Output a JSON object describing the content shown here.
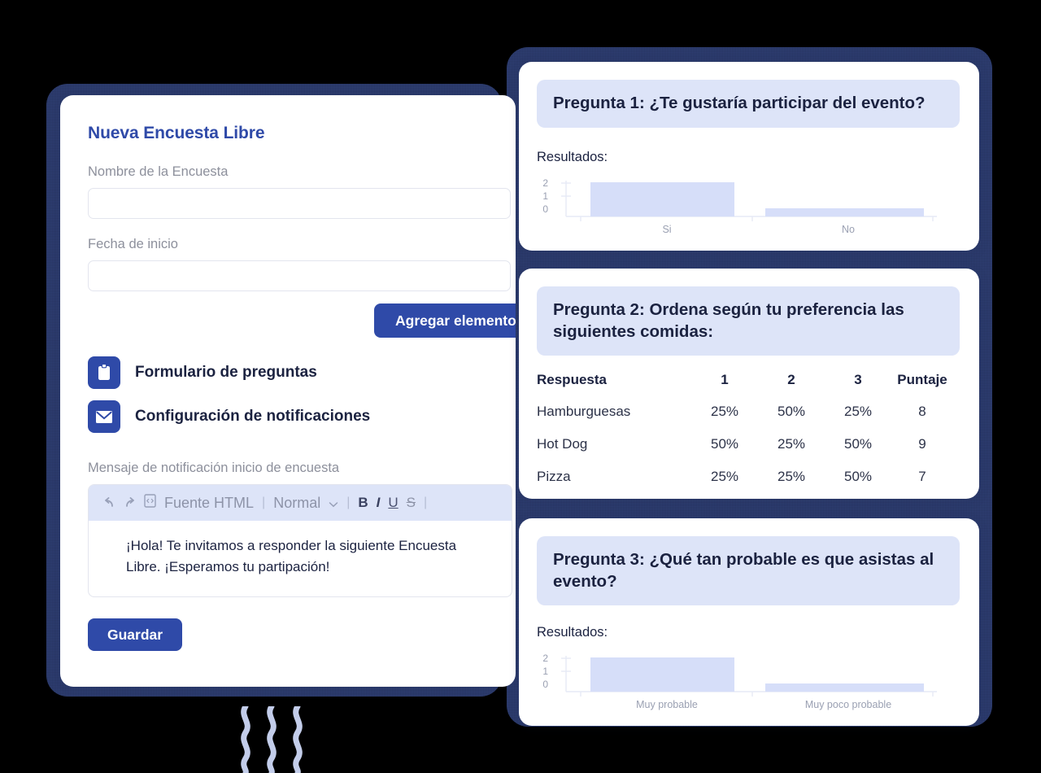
{
  "left_panel": {
    "title": "Nueva Encuesta Libre",
    "fields": [
      {
        "label": "Nombre de la Encuesta",
        "value": "",
        "placeholder": ""
      },
      {
        "label": "Fecha de inicio",
        "value": "",
        "placeholder": ""
      }
    ],
    "add_element_button": "Agregar elemento",
    "sections": [
      {
        "icon": "clipboard-icon",
        "label": "Formulario de preguntas"
      },
      {
        "icon": "envelope-icon",
        "label": "Configuración de notificaciones"
      }
    ],
    "editor_label": "Mensaje de notificación inicio de encuesta",
    "editor_toolbar": {
      "undo": "undo-icon",
      "redo": "redo-icon",
      "source_icon": "html-source-icon",
      "source_label": "Fuente HTML",
      "style_select": "Normal",
      "bold": "B",
      "italic": "I",
      "underline": "U",
      "strikethrough": "S"
    },
    "editor_body": "¡Hola! Te invitamos a responder la siguiente Encuesta Libre. ¡Esperamos tu partipación!",
    "save_button": "Guardar"
  },
  "right_panel": {
    "q1": {
      "title": "Pregunta 1: ¿Te gustaría participar del evento?",
      "results_label": "Resultados:"
    },
    "q2": {
      "title": "Pregunta 2: Ordena según tu preferencia las siguientes comidas:",
      "columns": [
        "Respuesta",
        "1",
        "2",
        "3",
        "Puntaje"
      ],
      "rows": [
        [
          "Hamburguesas",
          "25%",
          "50%",
          "25%",
          "8"
        ],
        [
          "Hot Dog",
          "50%",
          "25%",
          "50%",
          "9"
        ],
        [
          "Pizza",
          "25%",
          "25%",
          "50%",
          "7"
        ]
      ]
    },
    "q3": {
      "title": "Pregunta 3: ¿Qué tan probable es que asistas al evento?",
      "results_label": "Resultados:"
    }
  },
  "colors": {
    "accent": "#2f4aa8",
    "frame": "#2b3a6b",
    "header_band": "#dde4f8",
    "bar_fill": "#d6def9",
    "label_gray": "#8d909c",
    "squiggle": "#c3cdea"
  },
  "chart_data": [
    {
      "type": "bar",
      "title": "Pregunta 1: ¿Te gustaría participar del evento?",
      "categories": [
        "Si",
        "No"
      ],
      "values": [
        2,
        0.3
      ],
      "ticks": [
        "2",
        "1",
        "0"
      ],
      "ylim": [
        0,
        2
      ],
      "xlabel": "",
      "ylabel": "",
      "grid": false,
      "legend": "none"
    },
    {
      "type": "bar",
      "title": "Pregunta 3: ¿Qué tan probable es que asistas al evento?",
      "categories": [
        "Muy probable",
        "Muy poco probable"
      ],
      "values": [
        2,
        0.3
      ],
      "ticks": [
        "2",
        "1",
        "0"
      ],
      "ylim": [
        0,
        2
      ],
      "xlabel": "",
      "ylabel": "",
      "grid": false,
      "legend": "none"
    },
    {
      "type": "table",
      "title": "Pregunta 2: Ordena según tu preferencia las siguientes comidas:",
      "columns": [
        "Respuesta",
        "1",
        "2",
        "3",
        "Puntaje"
      ],
      "rows": [
        [
          "Hamburguesas",
          "25%",
          "50%",
          "25%",
          "8"
        ],
        [
          "Hot Dog",
          "50%",
          "25%",
          "50%",
          "9"
        ],
        [
          "Pizza",
          "25%",
          "25%",
          "50%",
          "7"
        ]
      ]
    }
  ]
}
